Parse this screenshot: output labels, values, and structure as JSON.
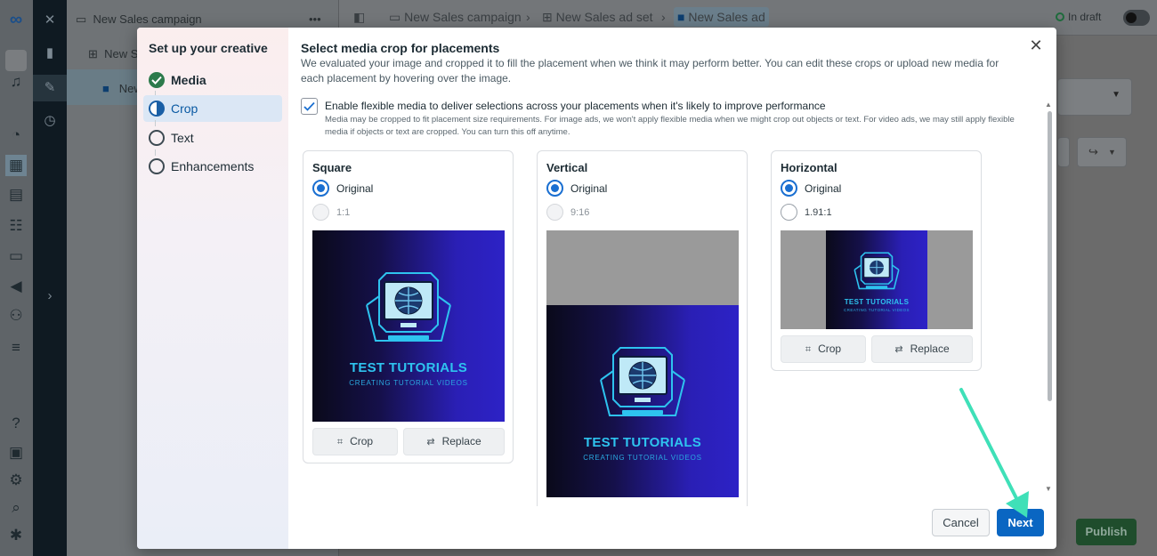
{
  "background": {
    "tree": {
      "campaign": "New Sales campaign",
      "adset": "New S",
      "ad": "New"
    },
    "breadcrumb": {
      "campaign": "New Sales campaign",
      "adset": "New Sales ad set",
      "ad": "New Sales ad"
    },
    "status": "In draft",
    "publish_label": "Publish"
  },
  "modal": {
    "sidebar_title": "Set up your creative",
    "steps": [
      {
        "label": "Media",
        "state": "done"
      },
      {
        "label": "Crop",
        "state": "current"
      },
      {
        "label": "Text",
        "state": "todo"
      },
      {
        "label": "Enhancements",
        "state": "todo"
      }
    ],
    "title": "Select media crop for placements",
    "description": "We evaluated your image and cropped it to fill the placement when we think it may perform better. You can edit these crops or upload new media for each placement by hovering over the image.",
    "flexible": {
      "checked": true,
      "label": "Enable flexible media to deliver selections across your placements when it's likely to improve performance",
      "help": "Media may be cropped to fit placement size requirements. For image ads, we won't apply flexible media when we might crop out objects or text. For video ads, we may still apply flexible media if objects or text are cropped. You can turn this off anytime."
    },
    "cards": {
      "square": {
        "title": "Square",
        "original": "Original",
        "ratio": "1:1",
        "crop": "Crop",
        "replace": "Replace"
      },
      "vertical": {
        "title": "Vertical",
        "original": "Original",
        "ratio": "9:16"
      },
      "horizontal": {
        "title": "Horizontal",
        "original": "Original",
        "ratio": "1.91:1",
        "crop": "Crop",
        "replace": "Replace"
      }
    },
    "image_text": {
      "headline": "TEST TUTORIALS",
      "tagline": "CREATING TUTORIAL VIDEOS"
    },
    "cancel_label": "Cancel",
    "next_label": "Next"
  },
  "colors": {
    "primary": "#0a66c2",
    "success": "#2c7a4b",
    "annotation_arrow": "#3fe0b8"
  }
}
